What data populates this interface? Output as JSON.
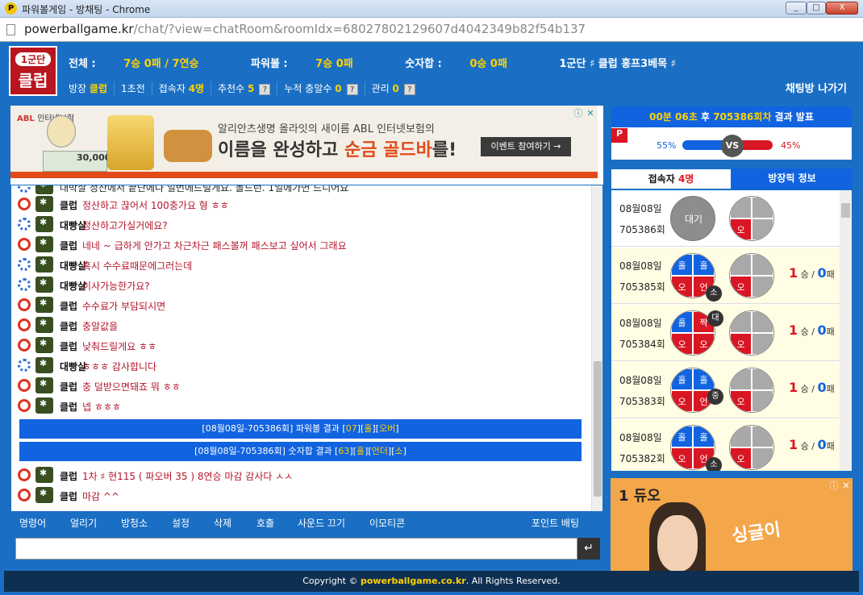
{
  "window": {
    "title": "파워볼게임 - 방채팅 - Chrome",
    "logo": "P",
    "controls": [
      "_",
      "□",
      "X"
    ]
  },
  "address": {
    "domain": "powerballgame.kr",
    "path": "/chat/?view=chatRoom&roomIdx=68027802129607d4042349b82f54b137"
  },
  "header": {
    "logo_top": "1군단",
    "logo_main": "클럽",
    "stats": {
      "total_label": "전체 :",
      "total_val": "7승 0패 / 7연승",
      "pb_label": "파워볼 :",
      "pb_val": "7승 0패",
      "sum_label": "숫자합 :",
      "sum_val": "0승 0패",
      "tags": "1군단 ♯ 클럽 홍프3베목 ♯"
    },
    "room": {
      "owner_label": "방장",
      "owner": "클럽",
      "level": "1초전",
      "users_label": "접속자",
      "users": "4명",
      "rec_label": "추천수",
      "rec": "5",
      "acc_label": "누적 충알수",
      "acc": "0",
      "admin_label": "관리",
      "admin": "0"
    },
    "exit": "채팅방 나가기",
    "help": "?"
  },
  "ad_top": {
    "brand": "ABL",
    "brand_sub": "인터넷보험",
    "line1": "알리안츠생명 올라잇의 새이름 ABL 인터넷보험의",
    "line2a": "이름을 완성하고 ",
    "line2b": "순금 골드바",
    "line2c": "를!",
    "cta": "이벤트 참여하기 →",
    "coupon": "30,000"
  },
  "chat": {
    "partial": "대박살  정산에서 끝단에다 일번에드릴게요. 돌드런. 1일에가면 드디어요",
    "messages": [
      {
        "nick": "클럽",
        "text": "정산하고 끊어서 100충가요 형 ㅎㅎ",
        "blue": false
      },
      {
        "nick": "대빵살",
        "text": "정산하고가실거에요?",
        "blue": true
      },
      {
        "nick": "클럽",
        "text": "네네 ~ 급하게 안가고 차근차근 패스볼꺼 패스보고 싶어서 그래요",
        "blue": false
      },
      {
        "nick": "대빵살",
        "text": "혹시 수수료때문에그러는데",
        "blue": true
      },
      {
        "nick": "대빵살",
        "text": "이사가능한가요?",
        "blue": true
      },
      {
        "nick": "클럽",
        "text": "수수료가 부담되시면",
        "blue": false
      },
      {
        "nick": "클럽",
        "text": "충알값을",
        "blue": false
      },
      {
        "nick": "클럽",
        "text": "낮춰드릴게요 ㅎㅎ",
        "blue": false
      },
      {
        "nick": "대빵살",
        "text": "ㅎㅎㅎ 감사합니다",
        "blue": true
      },
      {
        "nick": "클럽",
        "text": "충 덜받으면돼죠 뭐 ㅎㅎ",
        "blue": false
      },
      {
        "nick": "클럽",
        "text": "넵 ㅎㅎㅎ",
        "blue": false
      }
    ],
    "results": [
      {
        "a": "[08월08일-705386회] 파워볼 결과 [",
        "b": "07",
        "c": "][",
        "d": "홀",
        "e": "][",
        "f": "오버",
        "g": "]"
      },
      {
        "a": "[08월08일-705386회] 숫자합 결과 [",
        "b": "63",
        "c": "][",
        "d": "홀",
        "e": "][",
        "f": "언더",
        "g": "][",
        "h": "소",
        "i": "]"
      }
    ],
    "after": [
      {
        "nick": "클럽",
        "text": "1차 ♯ 현115 ( 파오버 35 ) 8연승 마감 감사다 ㅅㅅ",
        "blue": false
      },
      {
        "nick": "클럽",
        "text": "마감 ^^",
        "blue": false
      }
    ]
  },
  "menu": [
    "명령어",
    "얼리기",
    "방청소",
    "설정",
    "삭제",
    "호출",
    "사운드 끄기",
    "이모티콘",
    "포인트 배팅"
  ],
  "send": "↵",
  "result_box": {
    "pre": "00분",
    "sec": "06초",
    "mid": " 후 ",
    "round": "705386회차",
    "post": " 결과 발표",
    "p": "P",
    "left_pct": "55%",
    "right_pct": "45%",
    "vs": "VS"
  },
  "tabs": {
    "t1a": "접속자 ",
    "t1b": "4명",
    "t2": "방장픽 정보"
  },
  "picks": [
    {
      "date": "08월08일",
      "round": "705386회",
      "state": "대기",
      "cells": null,
      "badge": null,
      "res": "오",
      "win": null,
      "lose": null,
      "hl": false
    },
    {
      "date": "08월08일",
      "round": "705385회",
      "cells": [
        "홀",
        "홀",
        "오",
        "언"
      ],
      "badge": "소",
      "res": "오",
      "win": "1",
      "lose": "0",
      "hl": true
    },
    {
      "date": "08월08일",
      "round": "705384회",
      "cells": [
        "홀",
        "짝",
        "오",
        "오"
      ],
      "badge": "대",
      "res": "오",
      "win": "1",
      "lose": "0",
      "hl": true
    },
    {
      "date": "08월08일",
      "round": "705383회",
      "cells": [
        "홀",
        "홀",
        "오",
        "언"
      ],
      "badge": "중",
      "res": "오",
      "win": "1",
      "lose": "0",
      "hl": true
    },
    {
      "date": "08월08일",
      "round": "705382회",
      "cells": [
        "홀",
        "홀",
        "오",
        "언"
      ],
      "badge": "소",
      "res": "오",
      "win": "1",
      "lose": "0",
      "hl": true
    }
  ],
  "labels": {
    "win": "승",
    "lose": "패",
    "sep": " / "
  },
  "ad_right": {
    "title": "1 듀오",
    "script": "싱글이"
  },
  "footer": {
    "pre": "Copyright © ",
    "site": "powerballgame.co.kr",
    "post": ". All Rights Reserved."
  }
}
